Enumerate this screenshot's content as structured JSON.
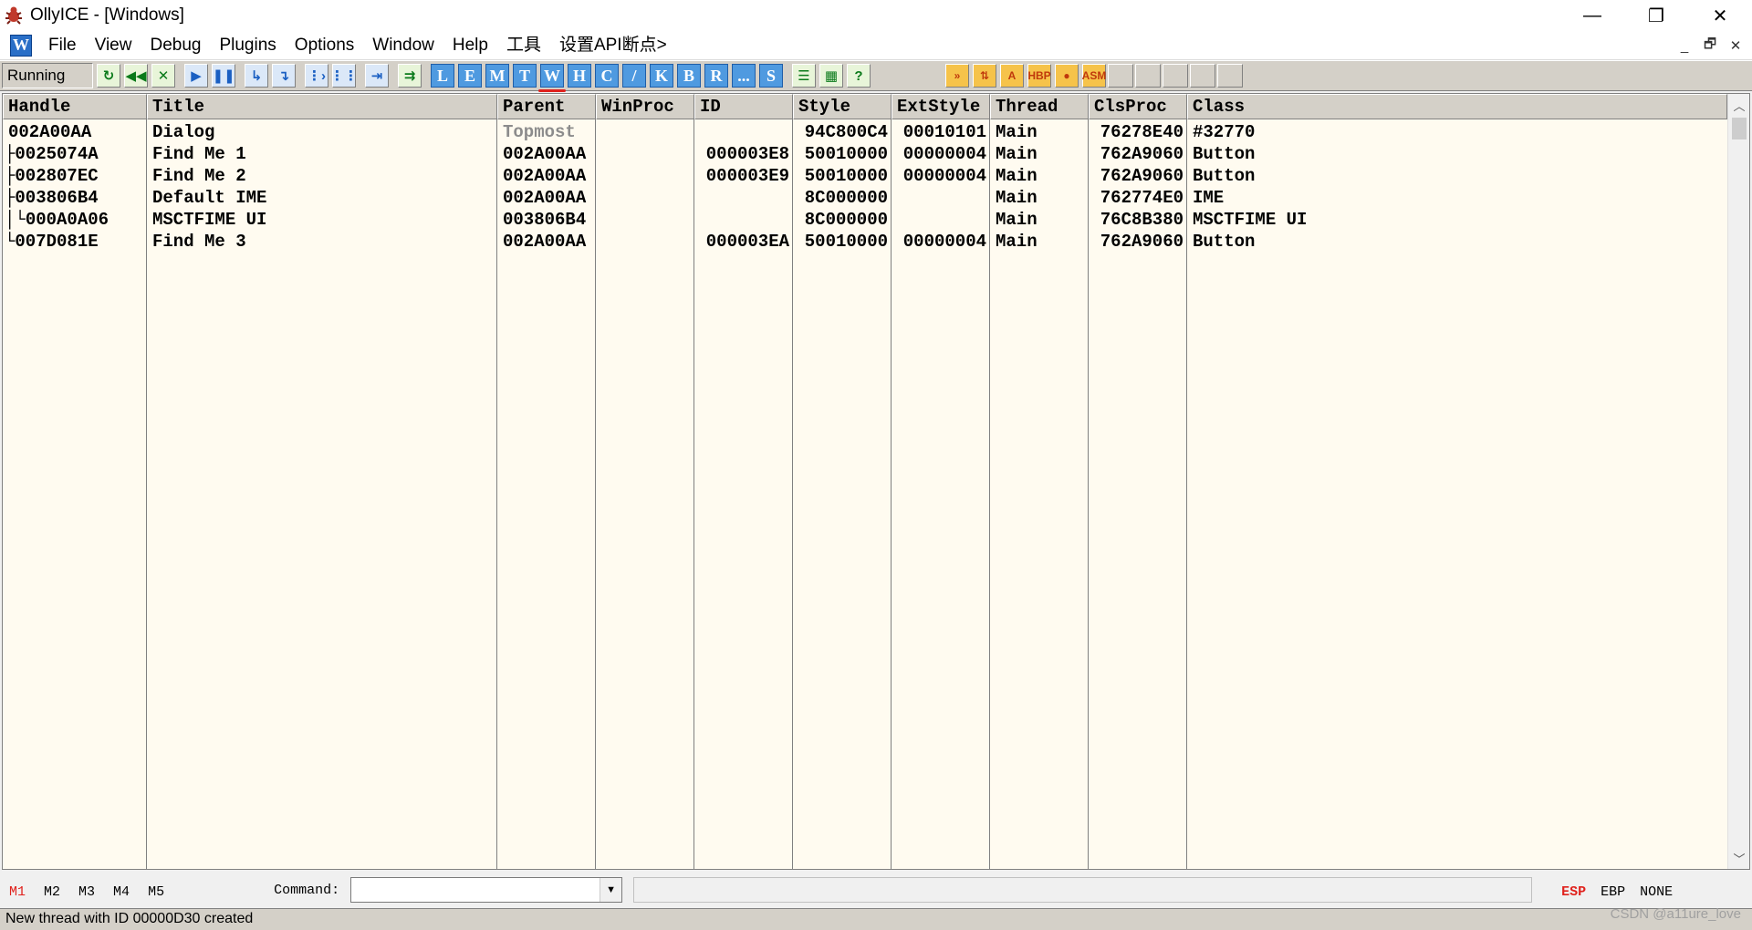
{
  "window": {
    "title": "OllyICE - [Windows]",
    "controls": {
      "minimize": "—",
      "restore": "❐",
      "close": "✕"
    }
  },
  "menubar": {
    "mdi_icon_letter": "W",
    "items": [
      "File",
      "View",
      "Debug",
      "Plugins",
      "Options",
      "Window",
      "Help",
      "工具",
      "设置API断点>"
    ],
    "mdi_controls": {
      "minimize": "_",
      "restore": "🗗",
      "close": "✕"
    }
  },
  "toolbar": {
    "status": "Running",
    "letter_buttons": [
      "L",
      "E",
      "M",
      "T",
      "W",
      "H",
      "C",
      "/",
      "K",
      "B",
      "R",
      "...",
      "S"
    ],
    "active_letter": "W",
    "orange_buttons": [
      "»",
      "⇅",
      "A",
      "HBP",
      "●",
      "ASM"
    ]
  },
  "table": {
    "headers": [
      "Handle",
      "Title",
      "Parent",
      "WinProc",
      "ID",
      "Style",
      "ExtStyle",
      "Thread",
      "ClsProc",
      "Class"
    ],
    "rows": [
      {
        "tree": "",
        "handle": "002A00AA",
        "title": "Dialog",
        "parent": "Topmost",
        "parent_gray": true,
        "winproc": "",
        "id": "",
        "style": "94C800C4",
        "extstyle": "00010101",
        "thread": "Main",
        "clsproc": "76278E40",
        "class": "#32770"
      },
      {
        "tree": "├",
        "handle": "0025074A",
        "title": "Find Me 1",
        "parent": "002A00AA",
        "parent_gray": false,
        "winproc": "",
        "id": "000003E8",
        "style": "50010000",
        "extstyle": "00000004",
        "thread": "Main",
        "clsproc": "762A9060",
        "class": "Button"
      },
      {
        "tree": "├",
        "handle": "002807EC",
        "title": "Find Me 2",
        "parent": "002A00AA",
        "parent_gray": false,
        "winproc": "",
        "id": "000003E9",
        "style": "50010000",
        "extstyle": "00000004",
        "thread": "Main",
        "clsproc": "762A9060",
        "class": "Button"
      },
      {
        "tree": "├",
        "handle": "003806B4",
        "title": "Default IME",
        "parent": "002A00AA",
        "parent_gray": false,
        "winproc": "",
        "id": "",
        "style": "8C000000",
        "extstyle": "",
        "thread": "Main",
        "clsproc": "762774E0",
        "class": "IME"
      },
      {
        "tree": "│└",
        "handle": "000A0A06",
        "title": "MSCTFIME UI",
        "parent": "003806B4",
        "parent_gray": false,
        "winproc": "",
        "id": "",
        "style": "8C000000",
        "extstyle": "",
        "thread": "Main",
        "clsproc": "76C8B380",
        "class": "MSCTFIME UI"
      },
      {
        "tree": "└",
        "handle": "007D081E",
        "title": "Find Me 3",
        "parent": "002A00AA",
        "parent_gray": false,
        "winproc": "",
        "id": "000003EA",
        "style": "50010000",
        "extstyle": "00000004",
        "thread": "Main",
        "clsproc": "762A9060",
        "class": "Button"
      }
    ]
  },
  "commandbar": {
    "memory_tabs": [
      "M1",
      "M2",
      "M3",
      "M4",
      "M5"
    ],
    "active_memory_tab": "M1",
    "command_label": "Command:",
    "command_value": "",
    "registers": [
      "ESP",
      "EBP",
      "NONE"
    ],
    "active_register": "ESP"
  },
  "statusbar": {
    "message": "New thread with ID 00000D30 created"
  },
  "watermark": "CSDN @a11ure_love"
}
